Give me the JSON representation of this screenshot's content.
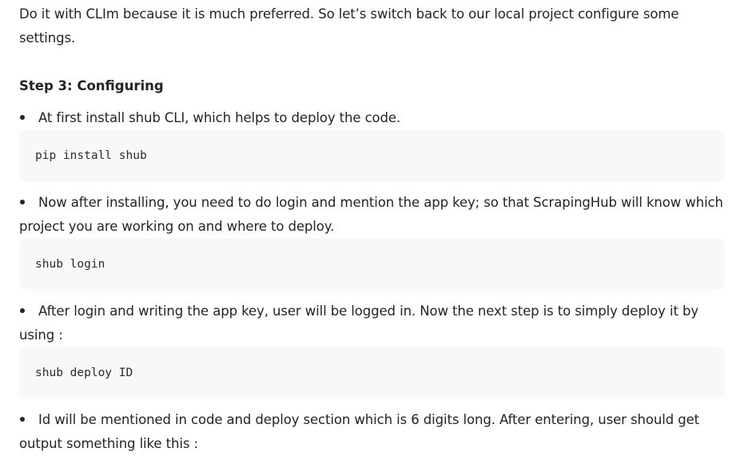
{
  "intro": "Do it with CLIm because it is much preferred. So let’s switch back to our local project configure some settings.",
  "step_heading": "Step 3: Configuring",
  "bullets": [
    "At first install shub CLI, which helps to deploy the code.",
    "Now after installing, you need to do login and mention the app key; so that ScrapingHub will know which project you are working on and where to deploy.",
    "After login and writing the app key, user will be logged in. Now the next step is to simply deploy it by using :",
    "Id will be mentioned in code and deploy section which is 6 digits long. After entering, user should get output something like this :"
  ],
  "code_blocks": [
    "pip install shub",
    "shub login",
    "shub deploy ID"
  ]
}
